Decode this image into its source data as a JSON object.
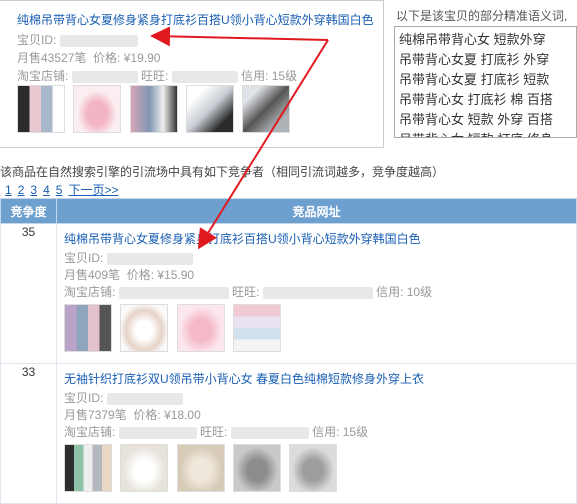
{
  "top": {
    "title": "纯棉吊带背心女夏修身紧身打底衫百搭U领小背心短款外穿韩国白色",
    "id_label": "宝贝ID:",
    "sales_label": "月售43527笔",
    "price_label": "价格:",
    "price": "¥19.90",
    "shop_label": "淘宝店铺:",
    "ww_label": "旺旺:",
    "credit": "信用:",
    "credit_level": "15级",
    "semantic_header": "以下是该宝贝的部分精准语义词,",
    "semantic_lines": [
      "纯棉吊带背心女  短款外穿",
      "吊带背心女夏  打底衫  外穿",
      "吊带背心女夏  打底衫  短款",
      "吊带背心女  打底衫  棉  百搭",
      "吊带背心女  短款  外穿  百搭",
      "吊带背心女  短款  打底  修身"
    ]
  },
  "note": "该商品在自然搜索引擎的引流场中具有如下竞争者（相同引流词越多，竞争度越高）",
  "pager": {
    "pages": [
      "1",
      "2",
      "3",
      "4",
      "5"
    ],
    "next": "下一页>>"
  },
  "table": {
    "col_score": "竞争度",
    "col_url": "竞品网址",
    "rows": [
      {
        "score": "35",
        "title": "纯棉吊带背心女夏修身紧身打底衫百搭U领小背心短款外穿韩国白色",
        "id_label": "宝贝ID:",
        "sales": "月售409笔",
        "price_label": "价格:",
        "price": "¥15.90",
        "shop_label": "淘宝店铺:",
        "ww_label": "旺旺:",
        "credit": "信用:",
        "credit_level": "10级"
      },
      {
        "score": "33",
        "title": "无袖针织打底衫双U领吊带小背心女 春夏白色纯棉短款修身外穿上衣",
        "id_label": "宝贝ID:",
        "sales": "月售7379笔",
        "price_label": "价格:",
        "price": "¥18.00",
        "shop_label": "淘宝店铺:",
        "ww_label": "旺旺:",
        "credit": "信用:",
        "credit_level": "15级"
      }
    ]
  },
  "colors": {
    "link": "#1a5fb4",
    "header_bg": "#6d9fcf",
    "arrow": "#e0191f"
  }
}
